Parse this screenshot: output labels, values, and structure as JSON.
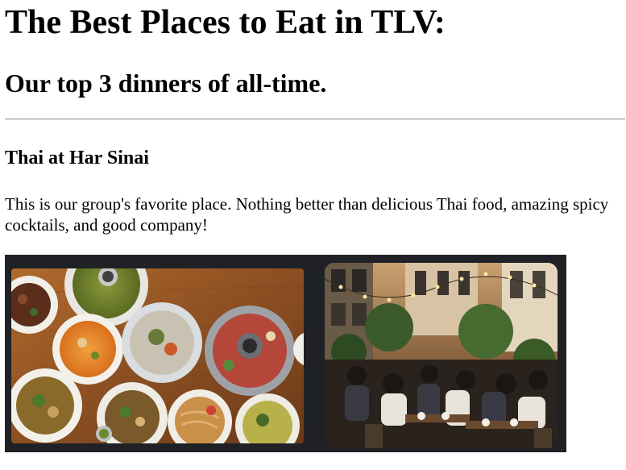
{
  "page": {
    "title": "The Best Places to Eat in TLV:",
    "subtitle": "Our top 3 dinners of all-time."
  },
  "restaurant": {
    "name": "Thai at Har Sinai",
    "description": "This is our group's favorite place. Nothing better than delicious Thai food, amazing spicy cocktails, and good company!"
  },
  "photos": [
    {
      "subject": "thai-food-spread-photo"
    },
    {
      "subject": "restaurant-courtyard-diners-photo"
    }
  ],
  "colors": {
    "text": "#000000",
    "rule": "#9a9a9a",
    "photo_frame": "#1f2126",
    "table_wood": "#9a5a28"
  }
}
